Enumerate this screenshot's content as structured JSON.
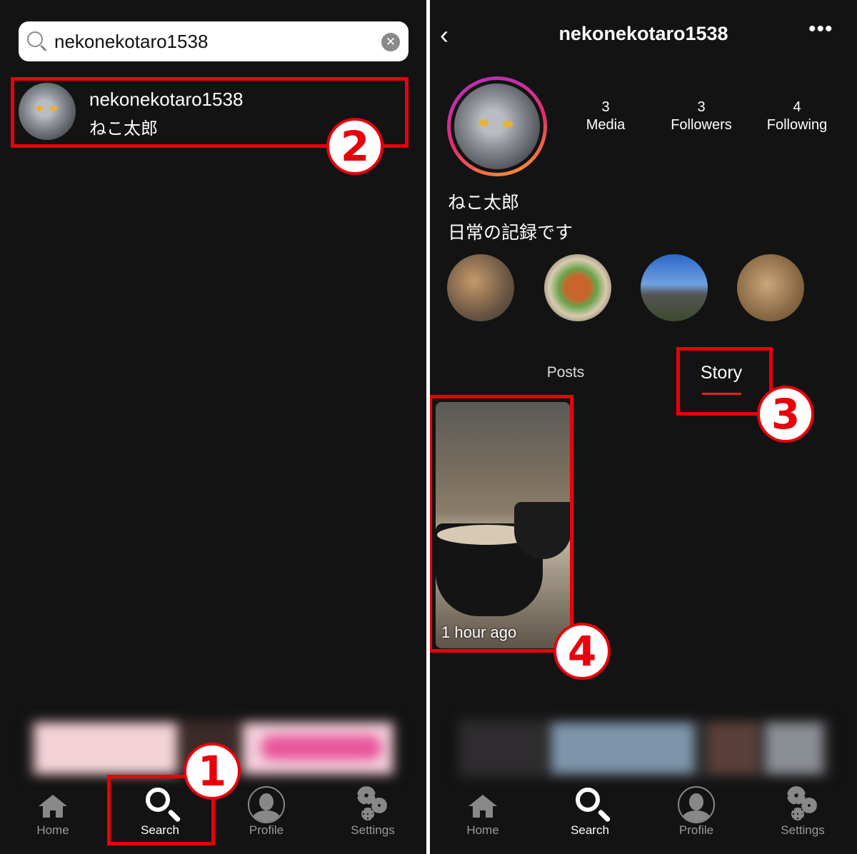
{
  "left": {
    "search": {
      "value": "nekonekotaro1538",
      "clear_icon": "clear-icon"
    },
    "result": {
      "username": "nekonekotaro1538",
      "display_name": "ねこ太郎"
    },
    "tabbar": [
      {
        "label": "Home",
        "icon": "home-icon"
      },
      {
        "label": "Search",
        "icon": "search-icon",
        "active": true
      },
      {
        "label": "Profile",
        "icon": "profile-icon"
      },
      {
        "label": "Settings",
        "icon": "settings-icon"
      }
    ]
  },
  "right": {
    "header": {
      "title": "nekonekotaro1538",
      "back_icon": "chevron-left-icon",
      "more_icon": "more-icon"
    },
    "stats": [
      {
        "value": "3",
        "label": "Media"
      },
      {
        "value": "3",
        "label": "Followers"
      },
      {
        "value": "4",
        "label": "Following"
      }
    ],
    "name": "ねこ太郎",
    "bio": "日常の記録です",
    "tabs": {
      "posts": "Posts",
      "story": "Story",
      "active": "Story"
    },
    "story": {
      "time": "1 hour ago"
    },
    "tabbar": [
      {
        "label": "Home",
        "icon": "home-icon"
      },
      {
        "label": "Search",
        "icon": "search-icon",
        "active": true
      },
      {
        "label": "Profile",
        "icon": "profile-icon"
      },
      {
        "label": "Settings",
        "icon": "settings-icon"
      }
    ]
  },
  "annotations": [
    "1",
    "2",
    "3",
    "4"
  ],
  "colors": {
    "background": "#131313",
    "highlight_red": "#e8000b",
    "tab_underline": "#e0202a"
  }
}
